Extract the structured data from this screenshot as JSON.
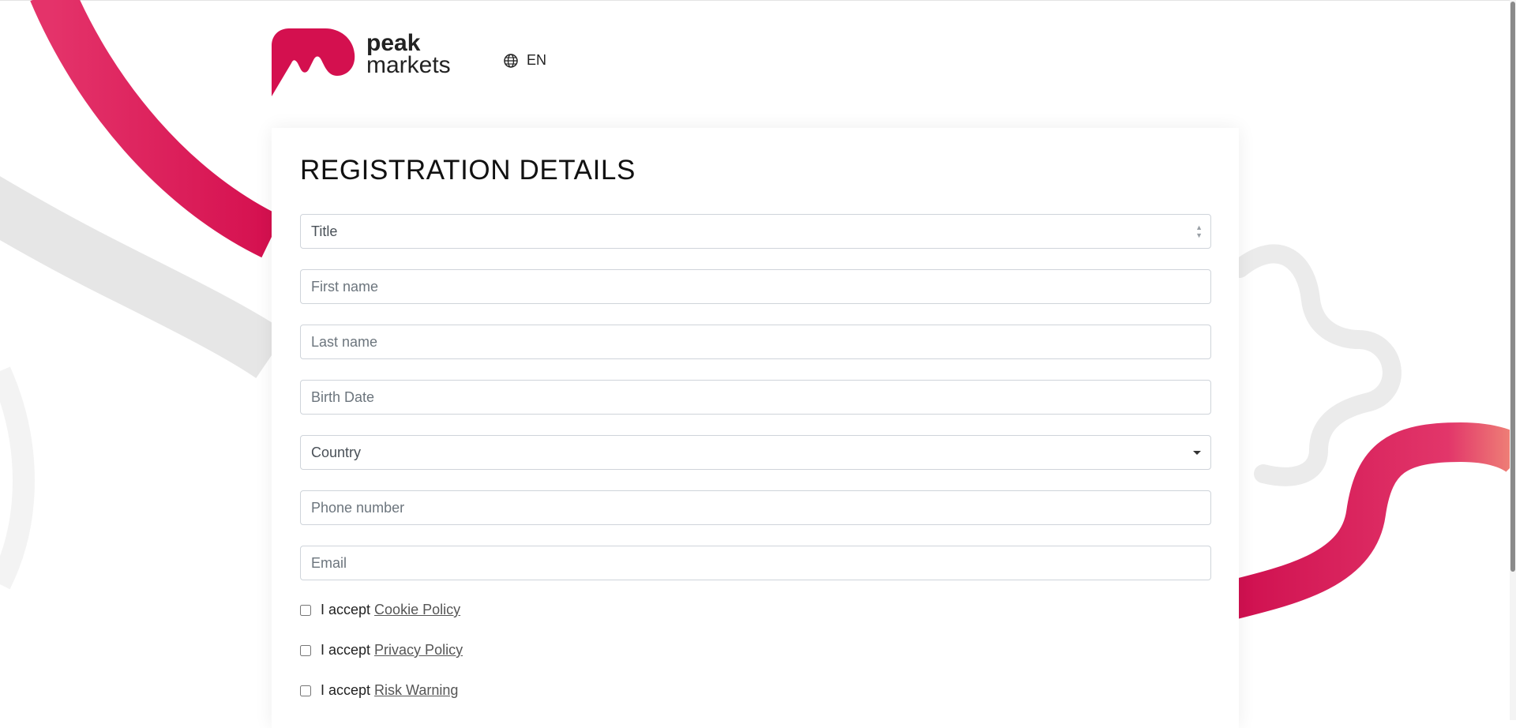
{
  "brand": {
    "name_line1": "peak",
    "name_line2": "markets"
  },
  "header": {
    "language": "EN",
    "language_icon": "globe-icon"
  },
  "form": {
    "title": "REGISTRATION DETAILS",
    "title_select": {
      "value": "Title"
    },
    "first_name": {
      "placeholder": "First name"
    },
    "last_name": {
      "placeholder": "Last name"
    },
    "birth_date": {
      "placeholder": "Birth Date"
    },
    "country_select": {
      "value": "Country"
    },
    "phone": {
      "placeholder": "Phone number"
    },
    "email": {
      "placeholder": "Email"
    },
    "consents": [
      {
        "prefix": "I accept",
        "link": "Cookie Policy"
      },
      {
        "prefix": "I accept",
        "link": "Privacy Policy"
      },
      {
        "prefix": "I accept",
        "link": "Risk Warning"
      }
    ]
  },
  "colors": {
    "brand": "#d4104f",
    "brand_light": "#ef7d77",
    "background_shape": "#e5e5e5"
  }
}
